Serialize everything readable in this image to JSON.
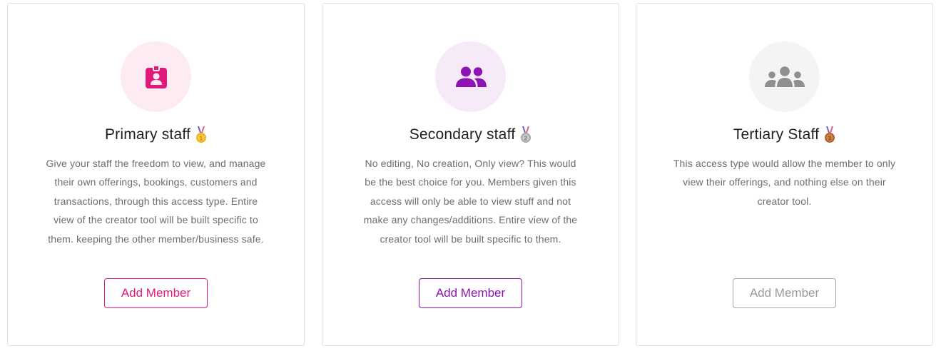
{
  "cards": [
    {
      "title": "Primary staff",
      "medal_icon": "gold-medal-icon",
      "description": "Give your staff the freedom to view, and manage their own offerings, bookings, customers and transactions, through this access type. Entire view of the creator tool will be built specific to them. keeping the other member/business safe.",
      "button_label": "Add Member",
      "accent_color": "#e0197b",
      "icon": "id-badge-icon"
    },
    {
      "title": "Secondary staff",
      "medal_icon": "silver-medal-icon",
      "description": "No editing, No creation, Only view? This would be the best choice for you. Members given this access will only be able to view stuff and not make any changes/additions. Entire view of the creator tool will be built specific to them.",
      "button_label": "Add Member",
      "accent_color": "#8e14b3",
      "icon": "user-group-icon"
    },
    {
      "title": "Tertiary Staff",
      "medal_icon": "bronze-medal-icon",
      "description": "This access type would allow the member to only view their offerings, and nothing else on their creator tool.",
      "button_label": "Add Member",
      "accent_color": "#9a9a9a",
      "icon": "users-icon"
    }
  ]
}
